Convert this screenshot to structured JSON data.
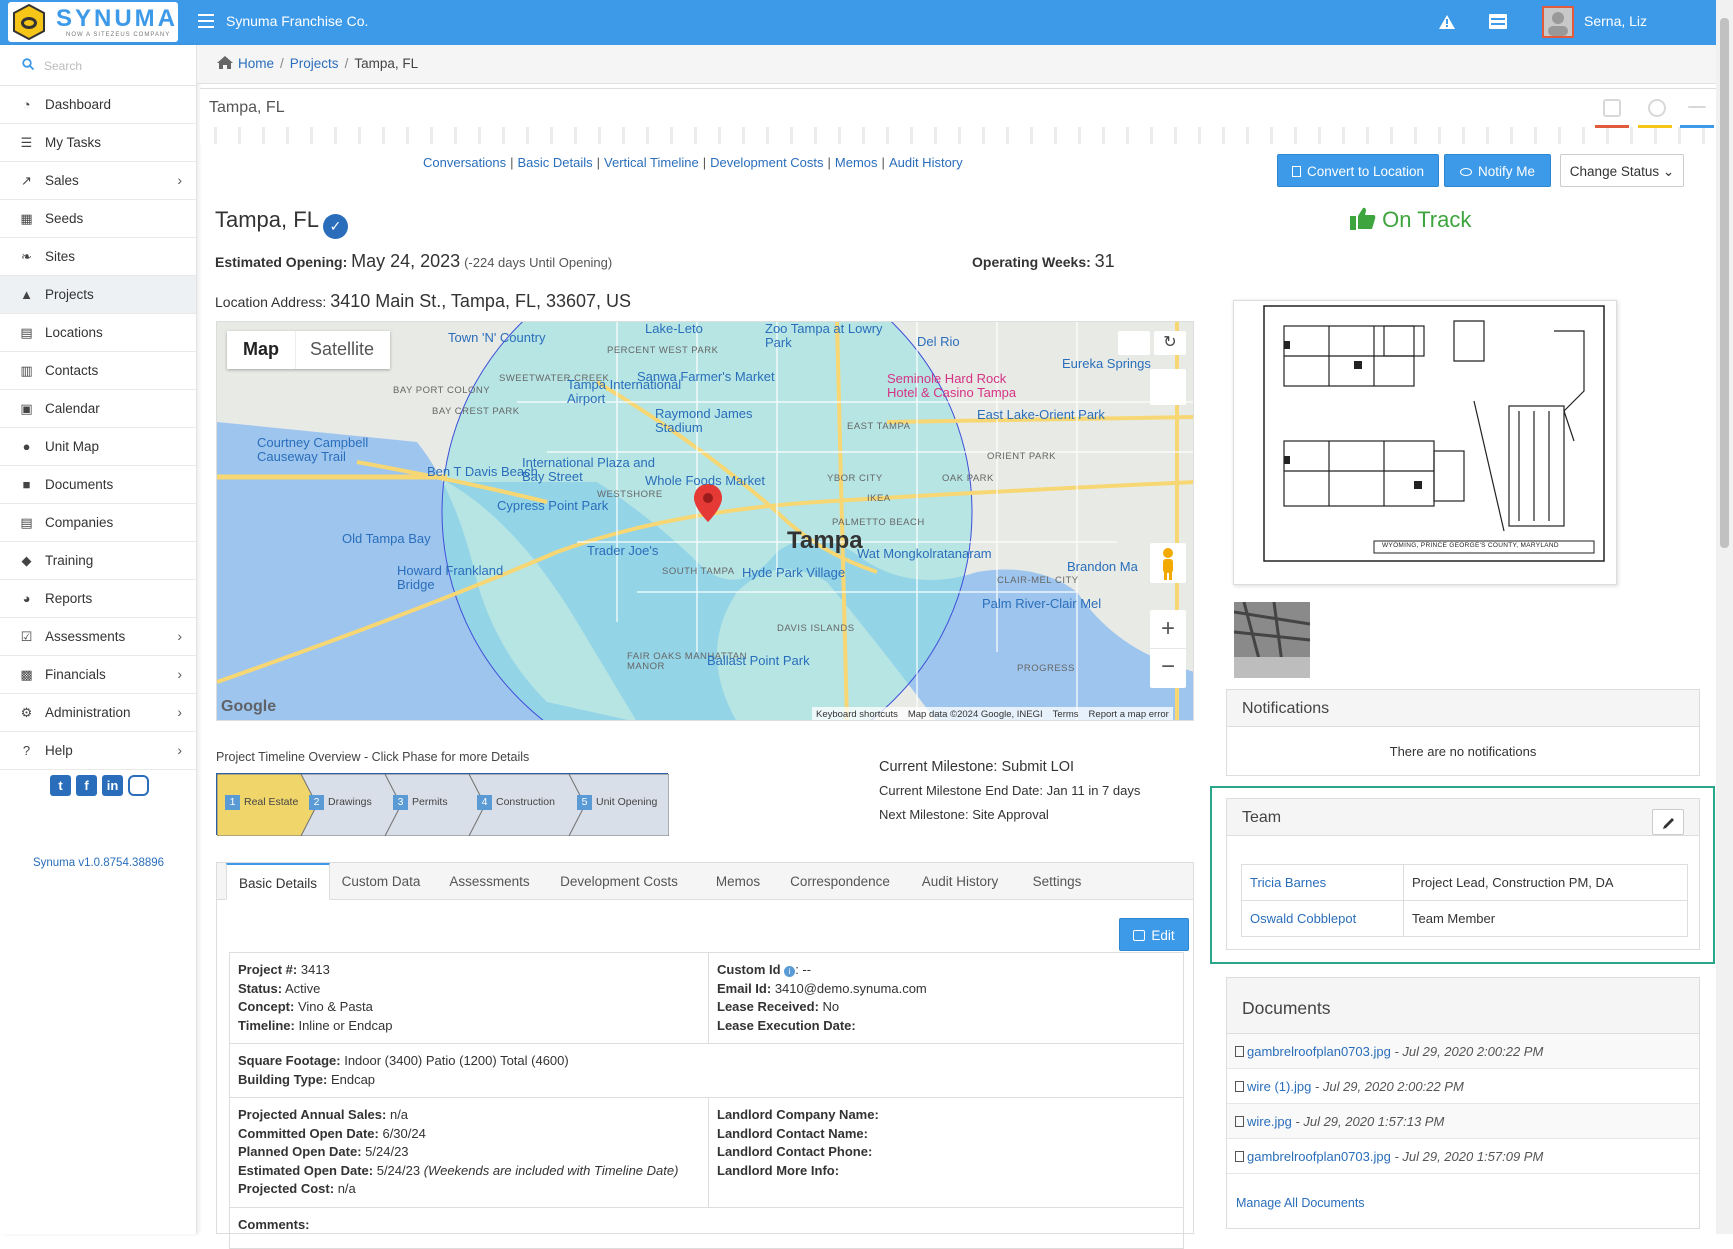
{
  "header": {
    "logo_text": "SYNUMA",
    "logo_tagline": "NOW A SITEZEUS COMPANY",
    "company": "Synuma Franchise Co.",
    "user_name": "Serna, Liz",
    "accent": "#3d9ae8"
  },
  "sidebar": {
    "search_placeholder": "Search",
    "items": [
      {
        "label": "Dashboard",
        "icon": "dashboard-icon"
      },
      {
        "label": "My Tasks",
        "icon": "list-icon"
      },
      {
        "label": "Sales",
        "icon": "line-chart-icon",
        "chevron": true
      },
      {
        "label": "Seeds",
        "icon": "grid-icon"
      },
      {
        "label": "Sites",
        "icon": "leaf-icon"
      },
      {
        "label": "Projects",
        "icon": "road-icon",
        "active": true
      },
      {
        "label": "Locations",
        "icon": "building-icon"
      },
      {
        "label": "Contacts",
        "icon": "address-book-icon"
      },
      {
        "label": "Calendar",
        "icon": "calendar-icon"
      },
      {
        "label": "Unit Map",
        "icon": "globe-icon"
      },
      {
        "label": "Documents",
        "icon": "file-icon"
      },
      {
        "label": "Companies",
        "icon": "building-icon"
      },
      {
        "label": "Training",
        "icon": "graduation-cap-icon"
      },
      {
        "label": "Reports",
        "icon": "pie-chart-icon"
      },
      {
        "label": "Assessments",
        "icon": "check-square-icon",
        "chevron": true
      },
      {
        "label": "Financials",
        "icon": "money-icon",
        "chevron": true
      },
      {
        "label": "Administration",
        "icon": "cogs-icon",
        "chevron": true
      },
      {
        "label": "Help",
        "icon": "question-icon",
        "chevron": true
      }
    ],
    "version": "Synuma v1.0.8754.38896"
  },
  "breadcrumb": {
    "home": "Home",
    "projects": "Projects",
    "current": "Tampa, FL"
  },
  "page_title": "Tampa, FL",
  "section_links": [
    "Conversations",
    "Basic Details",
    "Vertical Timeline",
    "Development Costs",
    "Memos",
    "Audit History"
  ],
  "buttons": {
    "convert": "Convert to Location",
    "notify": "Notify Me",
    "change_status": "Change Status"
  },
  "project": {
    "name": "Tampa, FL",
    "status_text": "On Track",
    "est_opening_label": "Estimated Opening:",
    "est_opening_date": "May 24, 2023",
    "est_opening_note": "(-224 days Until Opening)",
    "op_weeks_label": "Operating Weeks:",
    "op_weeks": "31",
    "address_label": "Location Address:",
    "address": "3410 Main St., Tampa, FL, 33607, US"
  },
  "map": {
    "btn_map": "Map",
    "btn_satellite": "Satellite",
    "city": "Tampa",
    "labels": [
      "Town 'N' Country",
      "Lake-Leto",
      "Zoo Tampa at Lowry Park",
      "Del Rio",
      "Eureka Springs",
      "PERCENT WEST PARK",
      "SWEETWATER CREEK",
      "Tampa International Airport",
      "Sanwa Farmer's Market",
      "Seminole Hard Rock Hotel & Casino Tampa",
      "BAY PORT COLONY",
      "BAY CREST PARK",
      "Raymond James Stadium",
      "East Lake-Orient Park",
      "Courtney Campbell Causeway Trail",
      "EAST TAMPA",
      "ORIENT PARK",
      "Ben T Davis Beach",
      "International Plaza and Bay Street",
      "Whole Foods Market",
      "YBOR CITY",
      "OAK PARK",
      "WESTSHORE",
      "IKEA",
      "Cypress Point Park",
      "PALMETTO BEACH",
      "Old Tampa Bay",
      "Trader Joe's",
      "Wat Mongkolratanaram",
      "Brandon Ma",
      "Howard Frankland Bridge",
      "SOUTH TAMPA",
      "Hyde Park Village",
      "CLAIR-MEL CITY",
      "Palm River-Clair Mel",
      "DAVIS ISLANDS",
      "FAIR OAKS MANHATTAN MANOR",
      "Ballast Point Park",
      "PROGRESS"
    ],
    "footer": [
      "Keyboard shortcuts",
      "Map data ©2024 Google, INEGI",
      "Terms",
      "Report a map error"
    ],
    "google": "Google"
  },
  "timeline": {
    "header": "Project Timeline Overview - Click Phase for more Details",
    "phases": [
      {
        "num": "1",
        "label": "Real Estate",
        "active": true
      },
      {
        "num": "2",
        "label": "Drawings"
      },
      {
        "num": "3",
        "label": "Permits"
      },
      {
        "num": "4",
        "label": "Construction"
      },
      {
        "num": "5",
        "label": "Unit Opening"
      }
    ],
    "current_milestone": "Current Milestone: Submit LOI",
    "end_date": "Current Milestone End Date: Jan 11 in 7 days",
    "next_milestone": "Next Milestone: Site Approval"
  },
  "tabs": [
    "Basic Details",
    "Custom Data",
    "Assessments",
    "Development Costs",
    "Memos",
    "Correspondence",
    "Audit History",
    "Settings"
  ],
  "edit_label": "Edit",
  "details": {
    "project_no_l": "Project #:",
    "project_no": "3413",
    "status_l": "Status:",
    "status": "Active",
    "concept_l": "Concept:",
    "concept": "Vino & Pasta",
    "timeline_l": "Timeline:",
    "timeline": "Inline or Endcap",
    "custom_id_l": "Custom Id",
    "custom_id": ": --",
    "email_id_l": "Email Id:",
    "email_id": "3410@demo.synuma.com",
    "lease_rec_l": "Lease Received:",
    "lease_rec": "No",
    "lease_exec_l": "Lease Execution Date:",
    "sqft_l": "Square Footage:",
    "sqft": "Indoor (3400) Patio (1200) Total (4600)",
    "btype_l": "Building Type:",
    "btype": "Endcap",
    "pas_l": "Projected Annual Sales:",
    "pas": "n/a",
    "cod_l": "Committed Open Date:",
    "cod": "6/30/24",
    "pod_l": "Planned Open Date:",
    "pod": "5/24/23",
    "eod_l": "Estimated Open Date:",
    "eod": "5/24/23",
    "eod_note": "(Weekends are included with Timeline Date)",
    "pc_l": "Projected Cost:",
    "pc": "n/a",
    "llcn_l": "Landlord Company Name:",
    "llcon_l": "Landlord Contact Name:",
    "llcp_l": "Landlord Contact Phone:",
    "llmi_l": "Landlord More Info:",
    "comments_l": "Comments:"
  },
  "notifications": {
    "title": "Notifications",
    "empty": "There are no notifications"
  },
  "team": {
    "title": "Team",
    "members": [
      {
        "name": "Tricia Barnes",
        "role": "Project Lead, Construction PM, DA"
      },
      {
        "name": "Oswald Cobblepot",
        "role": "Team Member"
      }
    ]
  },
  "documents": {
    "title": "Documents",
    "items": [
      {
        "name": "gambrelroofplan0703.jpg",
        "date": " - Jul 29, 2020 2:00:22 PM"
      },
      {
        "name": "wire (1).jpg",
        "date": " - Jul 29, 2020 2:00:22 PM"
      },
      {
        "name": "wire.jpg",
        "date": " - Jul 29, 2020 1:57:13 PM"
      },
      {
        "name": "gambrelroofplan0703.jpg",
        "date": " - Jul 29, 2020 1:57:09 PM"
      }
    ],
    "manage": "Manage All Documents"
  },
  "blueprint_caption": "WYOMING, PRINCE GEORGE'S COUNTY, MARYLAND"
}
